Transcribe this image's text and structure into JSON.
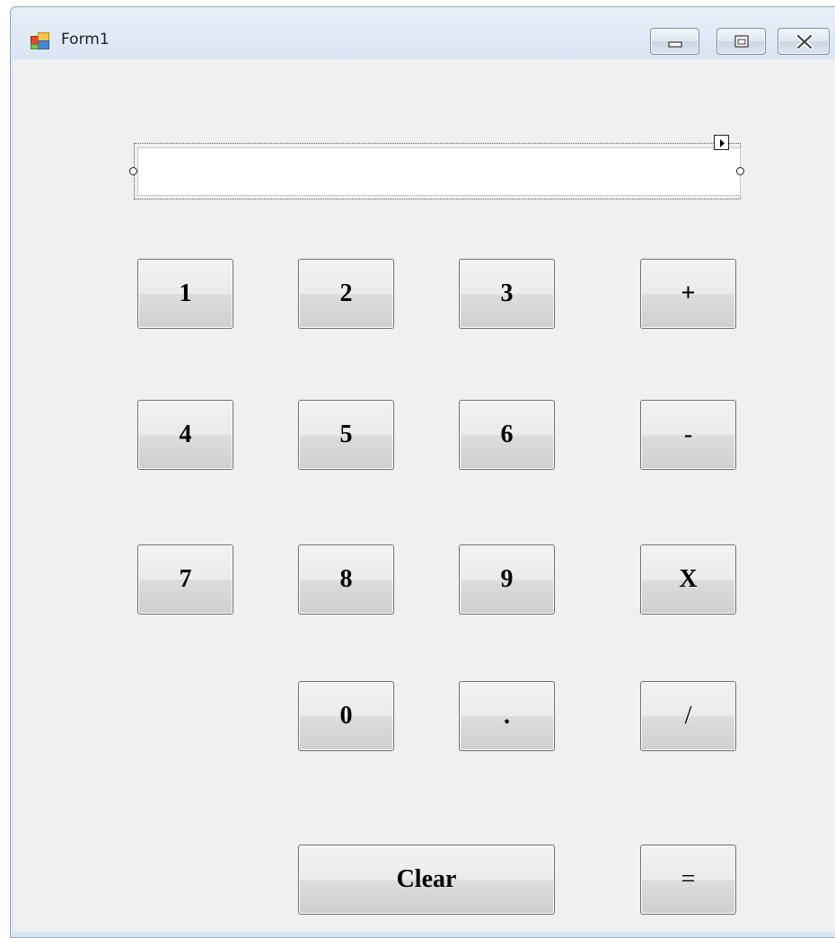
{
  "window": {
    "title": "Form1",
    "icon": "winforms-form-icon",
    "controls": [
      "minimize-icon",
      "maximize-icon",
      "close-icon"
    ]
  },
  "display": {
    "value": "",
    "placeholder": ""
  },
  "buttons": {
    "one": "1",
    "two": "2",
    "three": "3",
    "plus": "+",
    "four": "4",
    "five": "5",
    "six": "6",
    "minus": "-",
    "seven": "7",
    "eight": "8",
    "nine": "9",
    "multiply": "X",
    "zero": "0",
    "decimal": ".",
    "divide": "/",
    "clear": "Clear",
    "equals": "="
  },
  "colors": {
    "titlebar": "#dae5f3",
    "client": "#f0f0f0",
    "button_face": "#e5e5e5",
    "button_border": "#707070"
  }
}
